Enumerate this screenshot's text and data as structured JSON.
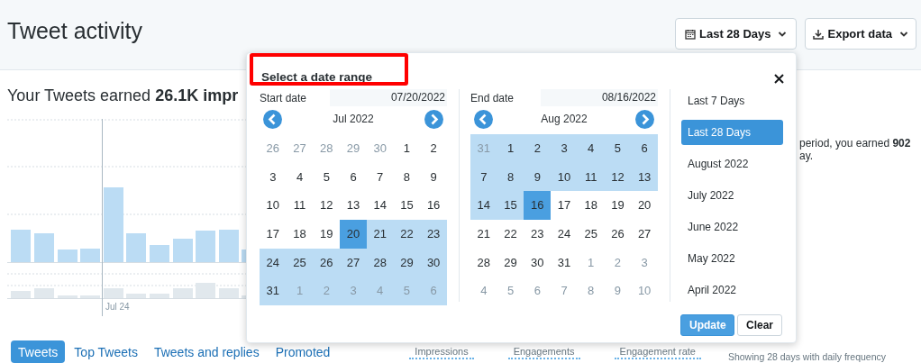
{
  "header": {
    "title": "Tweet activity",
    "date_button": "Last 28 Days",
    "export_button": "Export data"
  },
  "summary": {
    "headline": "Your Tweets earned **26.1K impr**",
    "side_text_1": "period, you earned **902**",
    "side_text_2": "ay."
  },
  "chart": {
    "axis_label": "Jul 24"
  },
  "tabs": [
    {
      "label": "Tweets",
      "selected": true
    },
    {
      "label": "Top Tweets",
      "selected": false
    },
    {
      "label": "Tweets and replies",
      "selected": false
    },
    {
      "label": "Promoted",
      "selected": false
    }
  ],
  "metrics": [
    "Impressions",
    "Engagements",
    "Engagement rate"
  ],
  "frequency_note": "Showing 28 days with daily frequency",
  "date_picker": {
    "title": "Select a date range",
    "highlighted": true,
    "calendars": [
      {
        "label": "Start date",
        "value": "07/20/2022",
        "month": "Jul 2022",
        "days": [
          {
            "d": "26",
            "outside": true,
            "in_range": false,
            "selected": false
          },
          {
            "d": "27",
            "outside": true,
            "in_range": false,
            "selected": false
          },
          {
            "d": "28",
            "outside": true,
            "in_range": false,
            "selected": false
          },
          {
            "d": "29",
            "outside": true,
            "in_range": false,
            "selected": false
          },
          {
            "d": "30",
            "outside": true,
            "in_range": false,
            "selected": false
          },
          {
            "d": "1",
            "outside": false,
            "in_range": false,
            "selected": false
          },
          {
            "d": "2",
            "outside": false,
            "in_range": false,
            "selected": false
          },
          {
            "d": "3",
            "outside": false,
            "in_range": false,
            "selected": false
          },
          {
            "d": "4",
            "outside": false,
            "in_range": false,
            "selected": false
          },
          {
            "d": "5",
            "outside": false,
            "in_range": false,
            "selected": false
          },
          {
            "d": "6",
            "outside": false,
            "in_range": false,
            "selected": false
          },
          {
            "d": "7",
            "outside": false,
            "in_range": false,
            "selected": false
          },
          {
            "d": "8",
            "outside": false,
            "in_range": false,
            "selected": false
          },
          {
            "d": "9",
            "outside": false,
            "in_range": false,
            "selected": false
          },
          {
            "d": "10",
            "outside": false,
            "in_range": false,
            "selected": false
          },
          {
            "d": "11",
            "outside": false,
            "in_range": false,
            "selected": false
          },
          {
            "d": "12",
            "outside": false,
            "in_range": false,
            "selected": false
          },
          {
            "d": "13",
            "outside": false,
            "in_range": false,
            "selected": false
          },
          {
            "d": "14",
            "outside": false,
            "in_range": false,
            "selected": false
          },
          {
            "d": "15",
            "outside": false,
            "in_range": false,
            "selected": false
          },
          {
            "d": "16",
            "outside": false,
            "in_range": false,
            "selected": false
          },
          {
            "d": "17",
            "outside": false,
            "in_range": false,
            "selected": false
          },
          {
            "d": "18",
            "outside": false,
            "in_range": false,
            "selected": false
          },
          {
            "d": "19",
            "outside": false,
            "in_range": false,
            "selected": false
          },
          {
            "d": "20",
            "outside": false,
            "in_range": false,
            "selected": true
          },
          {
            "d": "21",
            "outside": false,
            "in_range": true,
            "selected": false
          },
          {
            "d": "22",
            "outside": false,
            "in_range": true,
            "selected": false
          },
          {
            "d": "23",
            "outside": false,
            "in_range": true,
            "selected": false
          },
          {
            "d": "24",
            "outside": false,
            "in_range": true,
            "selected": false
          },
          {
            "d": "25",
            "outside": false,
            "in_range": true,
            "selected": false
          },
          {
            "d": "26",
            "outside": false,
            "in_range": true,
            "selected": false
          },
          {
            "d": "27",
            "outside": false,
            "in_range": true,
            "selected": false
          },
          {
            "d": "28",
            "outside": false,
            "in_range": true,
            "selected": false
          },
          {
            "d": "29",
            "outside": false,
            "in_range": true,
            "selected": false
          },
          {
            "d": "30",
            "outside": false,
            "in_range": true,
            "selected": false
          },
          {
            "d": "31",
            "outside": false,
            "in_range": true,
            "selected": false
          },
          {
            "d": "1",
            "outside": true,
            "in_range": true,
            "selected": false
          },
          {
            "d": "2",
            "outside": true,
            "in_range": true,
            "selected": false
          },
          {
            "d": "3",
            "outside": true,
            "in_range": true,
            "selected": false
          },
          {
            "d": "4",
            "outside": true,
            "in_range": true,
            "selected": false
          },
          {
            "d": "5",
            "outside": true,
            "in_range": true,
            "selected": false
          },
          {
            "d": "6",
            "outside": true,
            "in_range": true,
            "selected": false
          }
        ]
      },
      {
        "label": "End date",
        "value": "08/16/2022",
        "month": "Aug 2022",
        "days": [
          {
            "d": "31",
            "outside": true,
            "in_range": true,
            "selected": false
          },
          {
            "d": "1",
            "outside": false,
            "in_range": true,
            "selected": false
          },
          {
            "d": "2",
            "outside": false,
            "in_range": true,
            "selected": false
          },
          {
            "d": "3",
            "outside": false,
            "in_range": true,
            "selected": false
          },
          {
            "d": "4",
            "outside": false,
            "in_range": true,
            "selected": false
          },
          {
            "d": "5",
            "outside": false,
            "in_range": true,
            "selected": false
          },
          {
            "d": "6",
            "outside": false,
            "in_range": true,
            "selected": false
          },
          {
            "d": "7",
            "outside": false,
            "in_range": true,
            "selected": false
          },
          {
            "d": "8",
            "outside": false,
            "in_range": true,
            "selected": false
          },
          {
            "d": "9",
            "outside": false,
            "in_range": true,
            "selected": false
          },
          {
            "d": "10",
            "outside": false,
            "in_range": true,
            "selected": false
          },
          {
            "d": "11",
            "outside": false,
            "in_range": true,
            "selected": false
          },
          {
            "d": "12",
            "outside": false,
            "in_range": true,
            "selected": false
          },
          {
            "d": "13",
            "outside": false,
            "in_range": true,
            "selected": false
          },
          {
            "d": "14",
            "outside": false,
            "in_range": true,
            "selected": false
          },
          {
            "d": "15",
            "outside": false,
            "in_range": true,
            "selected": false
          },
          {
            "d": "16",
            "outside": false,
            "in_range": false,
            "selected": true
          },
          {
            "d": "17",
            "outside": false,
            "in_range": false,
            "selected": false
          },
          {
            "d": "18",
            "outside": false,
            "in_range": false,
            "selected": false
          },
          {
            "d": "19",
            "outside": false,
            "in_range": false,
            "selected": false
          },
          {
            "d": "20",
            "outside": false,
            "in_range": false,
            "selected": false
          },
          {
            "d": "21",
            "outside": false,
            "in_range": false,
            "selected": false
          },
          {
            "d": "22",
            "outside": false,
            "in_range": false,
            "selected": false
          },
          {
            "d": "23",
            "outside": false,
            "in_range": false,
            "selected": false
          },
          {
            "d": "24",
            "outside": false,
            "in_range": false,
            "selected": false
          },
          {
            "d": "25",
            "outside": false,
            "in_range": false,
            "selected": false
          },
          {
            "d": "26",
            "outside": false,
            "in_range": false,
            "selected": false
          },
          {
            "d": "27",
            "outside": false,
            "in_range": false,
            "selected": false
          },
          {
            "d": "28",
            "outside": false,
            "in_range": false,
            "selected": false
          },
          {
            "d": "29",
            "outside": false,
            "in_range": false,
            "selected": false
          },
          {
            "d": "30",
            "outside": false,
            "in_range": false,
            "selected": false
          },
          {
            "d": "31",
            "outside": false,
            "in_range": false,
            "selected": false
          },
          {
            "d": "1",
            "outside": true,
            "in_range": false,
            "selected": false
          },
          {
            "d": "2",
            "outside": true,
            "in_range": false,
            "selected": false
          },
          {
            "d": "3",
            "outside": true,
            "in_range": false,
            "selected": false
          },
          {
            "d": "4",
            "outside": true,
            "in_range": false,
            "selected": false
          },
          {
            "d": "5",
            "outside": true,
            "in_range": false,
            "selected": false
          },
          {
            "d": "6",
            "outside": true,
            "in_range": false,
            "selected": false
          },
          {
            "d": "7",
            "outside": true,
            "in_range": false,
            "selected": false
          },
          {
            "d": "8",
            "outside": true,
            "in_range": false,
            "selected": false
          },
          {
            "d": "9",
            "outside": true,
            "in_range": false,
            "selected": false
          },
          {
            "d": "10",
            "outside": true,
            "in_range": false,
            "selected": false
          }
        ]
      }
    ],
    "presets": [
      {
        "label": "Last 7 Days",
        "selected": false
      },
      {
        "label": "Last 28 Days",
        "selected": true
      },
      {
        "label": "August 2022",
        "selected": false
      },
      {
        "label": "July 2022",
        "selected": false
      },
      {
        "label": "June 2022",
        "selected": false
      },
      {
        "label": "May 2022",
        "selected": false
      },
      {
        "label": "April 2022",
        "selected": false
      }
    ],
    "buttons": [
      {
        "label": "Update",
        "kind": "primary"
      },
      {
        "label": "Clear",
        "kind": "secondary"
      }
    ]
  }
}
